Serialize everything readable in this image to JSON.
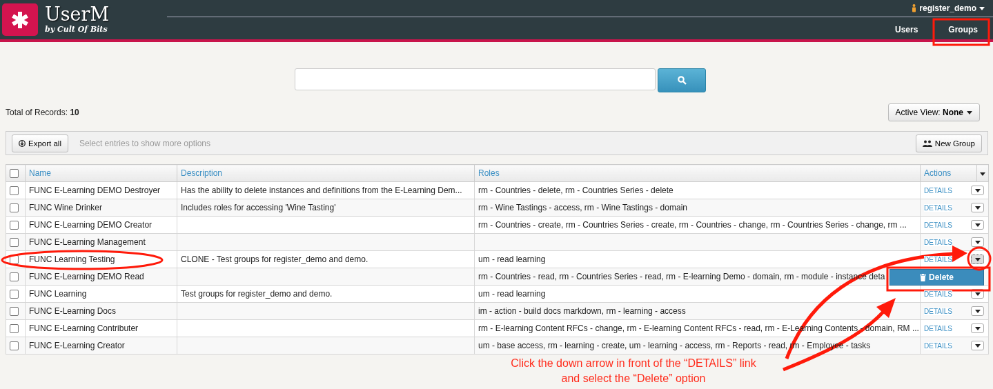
{
  "header": {
    "logo_title": "UserM",
    "logo_subtitle": "by Cult Of Bits",
    "user": "register_demo",
    "nav": [
      "Users",
      "Groups"
    ]
  },
  "total": {
    "label": "Total of Records:",
    "count": "10"
  },
  "active_view": {
    "label": "Active View:",
    "value": "None"
  },
  "toolbar": {
    "export": "Export all",
    "hint": "Select entries to show more options",
    "new_group": "New Group"
  },
  "table": {
    "select_all_checked": false,
    "columns": [
      "Name",
      "Description",
      "Roles",
      "Actions"
    ],
    "rows": [
      {
        "checked": false,
        "name": "FUNC E-Learning DEMO Destroyer",
        "description": "Has the ability to delete instances and definitions from the E-Learning Dem...",
        "roles": "rm - Countries - delete, rm - Countries Series - delete",
        "details": "DETAILS",
        "menu_open": false
      },
      {
        "checked": false,
        "name": "FUNC Wine Drinker",
        "description": "Includes roles for accessing 'Wine Tasting'",
        "roles": "rm - Wine Tastings - access, rm - Wine Tastings - domain",
        "details": "DETAILS",
        "menu_open": false
      },
      {
        "checked": false,
        "name": "FUNC E-Learning DEMO Creator",
        "roles": "rm - Countries - create, rm - Countries Series - create, rm - Countries - change, rm - Countries Series - change, rm ...",
        "details": "DETAILS",
        "menu_open": false
      },
      {
        "checked": false,
        "name": "FUNC E-Learning Management",
        "details": "DETAILS",
        "menu_open": false
      },
      {
        "checked": false,
        "name": "FUNC Learning Testing",
        "description": "CLONE - Test groups for register_demo and demo.",
        "roles": "um - read learning",
        "details": "DETAILS",
        "menu_open": true
      },
      {
        "checked": false,
        "name": "FUNC E-Learning DEMO Read",
        "roles": "rm - Countries - read, rm - Countries Series - read, rm - E-learning Demo - domain, rm - module - instance deta"
      },
      {
        "checked": false,
        "name": "FUNC Learning",
        "description": "Test groups for register_demo and demo.",
        "roles": "um - read learning",
        "details": "DETAILS",
        "menu_open": false
      },
      {
        "checked": false,
        "name": "FUNC E-Learning Docs",
        "roles": "im - action - build docs markdown, rm - learning - access",
        "details": "DETAILS",
        "menu_open": false
      },
      {
        "checked": false,
        "name": "FUNC E-Learning Contributer",
        "roles": "rm - E-learning Content RFCs - change, rm - E-learning Content RFCs - read, rm - E-Learning Contents - domain, RM ...",
        "details": "DETAILS",
        "menu_open": false
      },
      {
        "checked": false,
        "name": "FUNC E-Learning Creator",
        "roles": "um - base access, rm - learning - create, um - learning - access, rm - Reports - read, rm - Employee - tasks",
        "details": "DETAILS",
        "menu_open": false
      }
    ]
  },
  "dropdown_menu": {
    "items": [
      "Delete"
    ]
  },
  "annotation": {
    "text": "Click the down arrow in front of the “DETAILS” link and select the “Delete” option"
  }
}
